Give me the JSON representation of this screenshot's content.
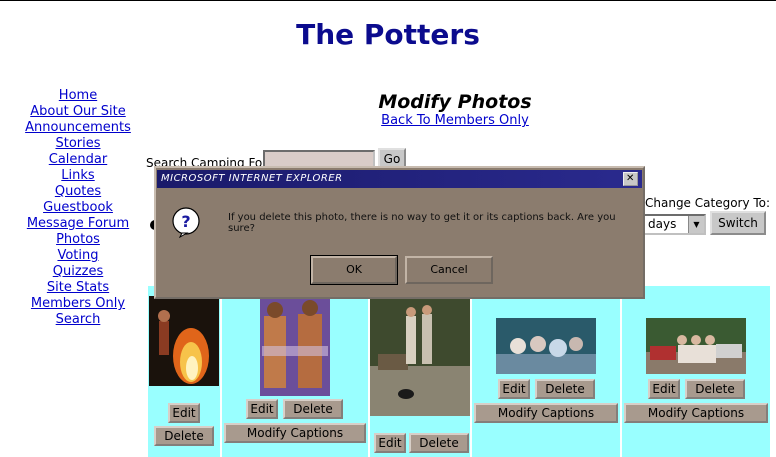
{
  "site": {
    "title": "The Potters"
  },
  "nav": {
    "items": [
      {
        "label": "Home"
      },
      {
        "label": "About Our Site"
      },
      {
        "label": "Announcements"
      },
      {
        "label": "Stories"
      },
      {
        "label": "Calendar"
      },
      {
        "label": "Links"
      },
      {
        "label": "Quotes"
      },
      {
        "label": "Guestbook"
      },
      {
        "label": "Message Forum"
      },
      {
        "label": "Photos"
      },
      {
        "label": "Voting"
      },
      {
        "label": "Quizzes"
      },
      {
        "label": "Site Stats"
      },
      {
        "label": "Members Only"
      },
      {
        "label": "Search"
      }
    ]
  },
  "page": {
    "heading": "Modify Photos",
    "back_link": "Back To Members Only"
  },
  "search": {
    "label": "Search Camping For",
    "value": "",
    "go_label": "Go"
  },
  "category": {
    "change_label": "Change Category To:",
    "selected": "days",
    "switch_label": "Switch"
  },
  "gallery": {
    "edit_label": "Edit",
    "delete_label": "Delete",
    "modify_captions_label": "Modify Captions"
  },
  "dialog": {
    "title": "MICROSOFT INTERNET EXPLORER",
    "close_glyph": "✕",
    "message": "If you delete this photo, there is no way to get it or its captions back.  Are you sure?",
    "ok_label": "OK",
    "cancel_label": "Cancel"
  },
  "colors": {
    "title_blue": "#0b0b8e",
    "link_blue": "#0000cc",
    "gallery_cyan": "#99ffff",
    "dialog_bg": "#8b7c6e"
  }
}
